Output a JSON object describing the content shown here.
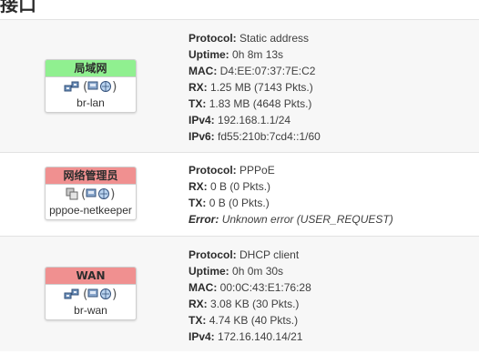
{
  "page": {
    "title": "接口"
  },
  "colors": {
    "lan_header": "#90f090",
    "pppoe_header": "#f09090",
    "wan_header": "#f09090",
    "row_alt": "#f7f7f7"
  },
  "interfaces": [
    {
      "name": "局域网",
      "device": "br-lan",
      "icons": [
        "ethernet-ports-icon",
        "bridge-icon"
      ],
      "details": [
        {
          "key": "Protocol:",
          "value": "Static address"
        },
        {
          "key": "Uptime:",
          "value": "0h 8m 13s"
        },
        {
          "key": "MAC:",
          "value": "D4:EE:07:37:7E:C2"
        },
        {
          "key": "RX:",
          "value": "1.25 MB (7143 Pkts.)"
        },
        {
          "key": "TX:",
          "value": "1.83 MB (4648 Pkts.)"
        },
        {
          "key": "IPv4:",
          "value": "192.168.1.1/24"
        },
        {
          "key": "IPv6:",
          "value": "fd55:210b:7cd4::1/60"
        }
      ]
    },
    {
      "name": "网络管理员",
      "device": "pppoe-netkeeper",
      "icons": [
        "tunnel-icon",
        "bridge-icon"
      ],
      "details": [
        {
          "key": "Protocol:",
          "value": "PPPoE"
        },
        {
          "key": "RX:",
          "value": "0 B (0 Pkts.)"
        },
        {
          "key": "TX:",
          "value": "0 B (0 Pkts.)"
        },
        {
          "key": "Error:",
          "value": "Unknown error (USER_REQUEST)"
        }
      ]
    },
    {
      "name": "WAN",
      "device": "br-wan",
      "icons": [
        "ethernet-ports-icon",
        "bridge-icon"
      ],
      "details": [
        {
          "key": "Protocol:",
          "value": "DHCP client"
        },
        {
          "key": "Uptime:",
          "value": "0h 0m 30s"
        },
        {
          "key": "MAC:",
          "value": "00:0C:43:E1:76:28"
        },
        {
          "key": "RX:",
          "value": "3.08 KB (30 Pkts.)"
        },
        {
          "key": "TX:",
          "value": "4.74 KB (40 Pkts.)"
        },
        {
          "key": "IPv4:",
          "value": "172.16.140.14/21"
        }
      ]
    }
  ]
}
